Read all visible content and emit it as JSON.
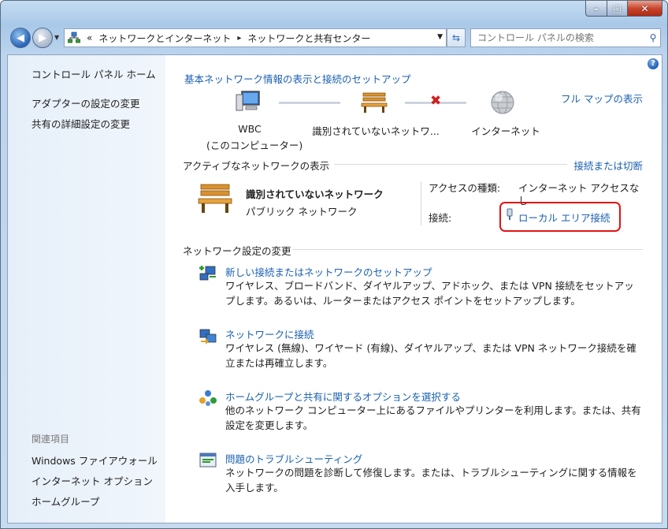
{
  "window": {
    "min_label": "–",
    "max_label": "□",
    "close_label": "✕"
  },
  "navbar": {
    "breadcrumb_prefix": "«",
    "breadcrumb": [
      "ネットワークとインターネット",
      "ネットワークと共有センター"
    ],
    "breadcrumb_sep": "▸",
    "search_placeholder": "コントロール パネルの検索"
  },
  "sidebar": {
    "home": "コントロール パネル ホーム",
    "items": [
      "アダプターの設定の変更",
      "共有の詳細設定の変更"
    ],
    "related_title": "関連項目",
    "related": [
      "Windows ファイアウォール",
      "インターネット オプション",
      "ホームグループ"
    ]
  },
  "main": {
    "heading": "基本ネットワーク情報の表示と接続のセットアップ",
    "full_map": "フル マップの表示",
    "map": {
      "computer_name": "WBC",
      "computer_sub": "(このコンピューター)",
      "network": "識別されていないネットワ...",
      "internet": "インターネット"
    },
    "active_title": "アクティブなネットワークの表示",
    "connect_disconnect": "接続または切断",
    "active": {
      "name": "識別されていないネットワーク",
      "type": "パブリック ネットワーク",
      "access_label": "アクセスの種類:",
      "access_value": "インターネット アクセスな",
      "access_value_wrap": "し",
      "conn_label": "接続:",
      "conn_value": "ローカル エリア接続"
    },
    "change_title": "ネットワーク設定の変更",
    "tasks": [
      {
        "title": "新しい接続またはネットワークのセットアップ",
        "desc": "ワイヤレス、ブロードバンド、ダイヤルアップ、アドホック、または VPN 接続をセットアップします。あるいは、ルーターまたはアクセス ポイントをセットアップします。"
      },
      {
        "title": "ネットワークに接続",
        "desc": "ワイヤレス (無線)、ワイヤード (有線)、ダイヤルアップ、または VPN ネットワーク接続を確立または再確立します。"
      },
      {
        "title": "ホームグループと共有に関するオプションを選択する",
        "desc": "他のネットワーク コンピューター上にあるファイルやプリンターを利用します。または、共有設定を変更します。"
      },
      {
        "title": "問題のトラブルシューティング",
        "desc": "ネットワークの問題を診断して修復します。または、トラブルシューティングに関する情報を入手します。"
      }
    ]
  },
  "colors": {
    "link": "#1a5fb0",
    "highlight_border": "#e01414",
    "x_mark": "#d21f1f"
  }
}
